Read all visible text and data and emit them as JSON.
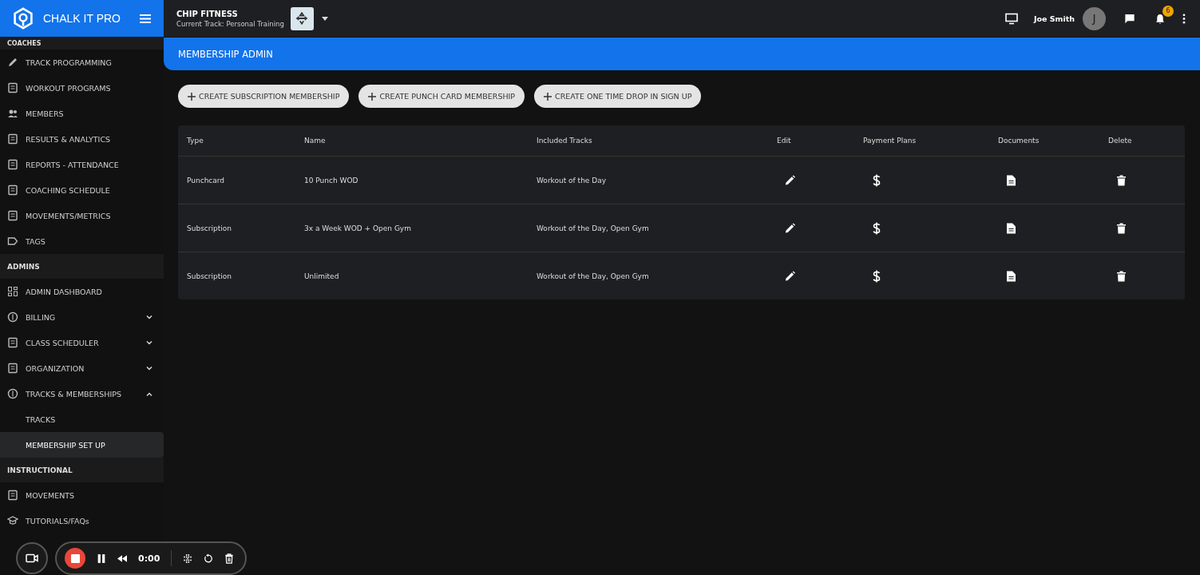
{
  "app": {
    "name": "CHALK IT PRO"
  },
  "gym": {
    "name": "CHIP FITNESS",
    "track": "Current Track: Personal Training"
  },
  "user": {
    "name": "Joe Smith",
    "initial": "J",
    "notifications": "6"
  },
  "sidebar": {
    "sections": [
      {
        "title": "COACHES",
        "items": [
          {
            "label": "TRACK PROGRAMMING",
            "selected": false
          },
          {
            "label": "WORKOUT PROGRAMS",
            "selected": false
          },
          {
            "label": "MEMBERS",
            "selected": false
          },
          {
            "label": "RESULTS & ANALYTICS",
            "selected": false
          },
          {
            "label": "REPORTS - ATTENDANCE",
            "selected": false
          },
          {
            "label": "COACHING SCHEDULE",
            "selected": false
          },
          {
            "label": "MOVEMENTS/METRICS",
            "selected": false
          },
          {
            "label": "TAGS",
            "selected": false
          }
        ]
      },
      {
        "title": "ADMINS",
        "items": [
          {
            "label": "ADMIN DASHBOARD",
            "selected": false
          },
          {
            "label": "BILLING",
            "selected": false,
            "expanded": false
          },
          {
            "label": "CLASS SCHEDULER",
            "selected": false,
            "expanded": false
          },
          {
            "label": "ORGANIZATION",
            "selected": false,
            "expanded": false
          },
          {
            "label": "TRACKS & MEMBERSHIPS",
            "selected": false,
            "expanded": true,
            "children": [
              {
                "label": "TRACKS",
                "selected": false
              },
              {
                "label": "MEMBERSHIP SET UP",
                "selected": true
              }
            ]
          }
        ]
      },
      {
        "title": "INSTRUCTIONAL",
        "items": [
          {
            "label": "MOVEMENTS",
            "selected": false
          },
          {
            "label": "TUTORIALS/FAQs",
            "selected": false
          }
        ]
      }
    ]
  },
  "page": {
    "title": "MEMBERSHIP ADMIN"
  },
  "actions": [
    "CREATE SUBSCRIPTION MEMBERSHIP",
    "CREATE PUNCH CARD MEMBERSHIP",
    "CREATE ONE TIME DROP IN SIGN UP"
  ],
  "table": {
    "columns": [
      "Type",
      "Name",
      "Included Tracks",
      "Edit",
      "Payment Plans",
      "Documents",
      "Delete"
    ],
    "rows": [
      {
        "type": "Punchcard",
        "name": "10 Punch WOD",
        "tracks": "Workout of the Day"
      },
      {
        "type": "Subscription",
        "name": "3x a Week WOD + Open Gym",
        "tracks": "Workout of the Day, Open Gym"
      },
      {
        "type": "Subscription",
        "name": "Unlimited",
        "tracks": "Workout of the Day, Open Gym"
      }
    ]
  },
  "recorder": {
    "time": "0:00"
  }
}
